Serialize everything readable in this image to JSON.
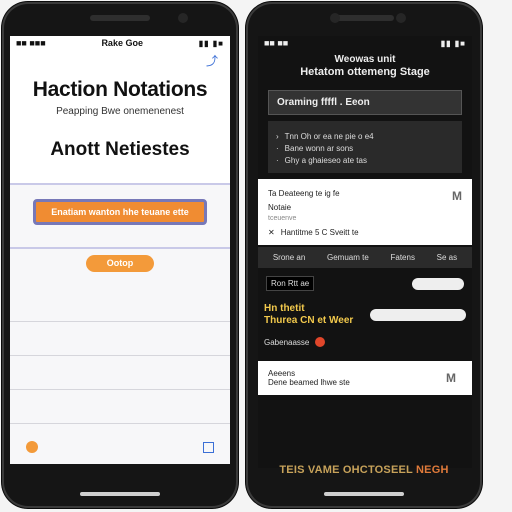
{
  "left_phone": {
    "status": {
      "time": "■■ ■■■",
      "carrier": "Rake Goe",
      "icons": "▮▮ ▮■"
    },
    "header": {
      "title": "Haction Notations",
      "subtitle": "Peapping Bwe onemenenest",
      "heading": "Anott Netiestes"
    },
    "field": {
      "value": "Enatiam wanton hhe teuane ette"
    },
    "button": {
      "label": "Ootop"
    },
    "rows_count": 4
  },
  "right_phone": {
    "status": {
      "time": "■■ ■■",
      "icons": "▮▮ ▮■"
    },
    "title_line1": "Weowas unit",
    "title_line2": "Hetatom ottemeng Stage",
    "panel": {
      "label": "Oraming ffffl . Eeon"
    },
    "block_lines": [
      "Tnn Oh or ea ne pie o e4",
      "Bane wonn ar sons",
      "Ghy a ghaieseo ate tas"
    ],
    "card1": {
      "line1": "Ta Deateeng te ig fe",
      "line2": "Notaie",
      "muted": "tceuenve",
      "line3": "Hantitme 5 C Sveitt te",
      "meta": "M"
    },
    "tabs": [
      "Srone an",
      "Gemuam te",
      "Fatens",
      "Se as"
    ],
    "toggle_row": {
      "label": "Ron Rtt ae"
    },
    "yellow": {
      "line1": "Hn thetit",
      "line2": "Thurea CN et Weer"
    },
    "dot_row": {
      "label": "Gabenaasse"
    },
    "card2": {
      "line1": "Aeeens",
      "line2": "Dene beamed lhwe ste",
      "meta": "M"
    },
    "caption": {
      "main": "TEIS VAME OHCTOSEEL",
      "accent": "NEGH"
    }
  },
  "colors": {
    "accent_orange": "#f08c32",
    "field_border": "#7778b8",
    "dark_bg": "#121212",
    "caption_gold": "#c7a25a",
    "alert_red": "#e0462a"
  }
}
